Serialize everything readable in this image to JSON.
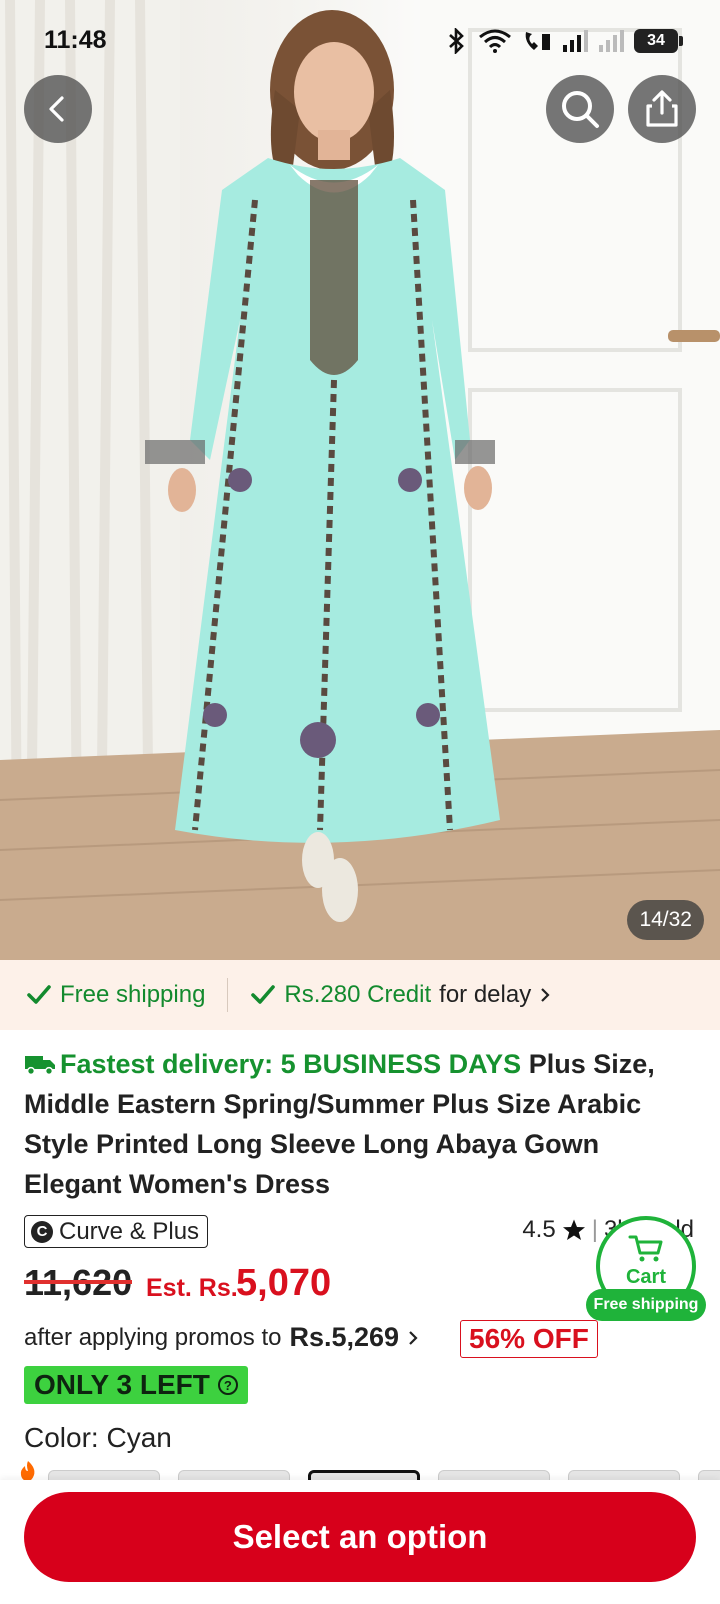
{
  "status_bar": {
    "time": "11:48",
    "battery": "34"
  },
  "gallery": {
    "counter": "14/32"
  },
  "shipping_strip": {
    "free_shipping": "Free shipping",
    "credit": "Rs.280 Credit",
    "credit_suffix": "for delay"
  },
  "product": {
    "fastest_delivery": "Fastest delivery: 5 BUSINESS DAYS",
    "title": "Plus Size, Middle Eastern Spring/Summer Plus Size Arabic Style Printed Long Sleeve Long Abaya Gown Elegant Women's Dress",
    "brand": "Curve & Plus",
    "brand_logo": "C",
    "rating": "4.5",
    "sold": "3k+ sold",
    "original_price": "11,620",
    "est_label": "Est. Rs.",
    "est_price": "5,070",
    "promo_prefix": "after applying promos to",
    "promo_price": "Rs.5,269",
    "discount": "56% OFF",
    "stock": "ONLY 3 LEFT",
    "color_label": "Color: Cyan"
  },
  "cart": {
    "label": "Cart",
    "badge": "Free shipping"
  },
  "actions": {
    "select_option": "Select an option"
  },
  "colors": {
    "accent_red": "#d7001b",
    "accent_green": "#1fb33a",
    "dress_cyan": "#a6ebe0"
  }
}
